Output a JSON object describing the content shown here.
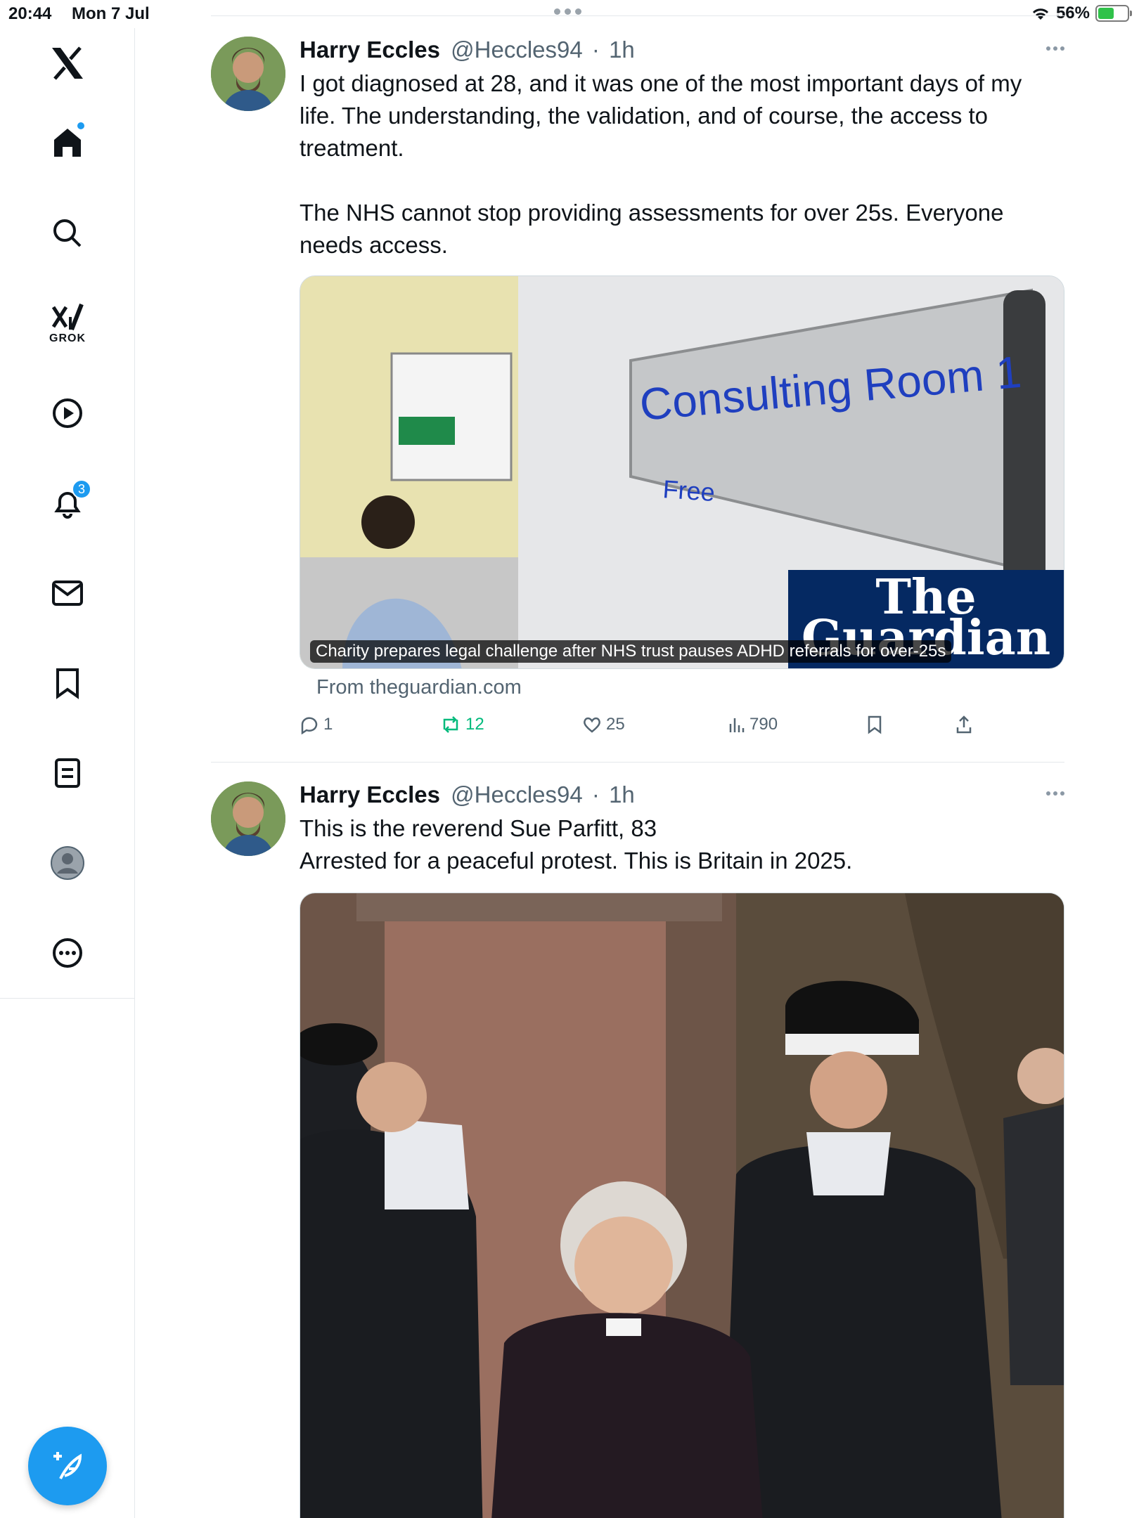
{
  "status_bar": {
    "time": "20:44",
    "date": "Mon 7 Jul",
    "battery": "56%",
    "battery_level": 0.56
  },
  "sidebar": {
    "items": [
      {
        "name": "x-logo-icon"
      },
      {
        "name": "home-icon",
        "has_dot": true
      },
      {
        "name": "search-icon"
      },
      {
        "name": "grok-icon",
        "label": "GROK"
      },
      {
        "name": "video-icon"
      },
      {
        "name": "notifications-icon",
        "badge": "3"
      },
      {
        "name": "messages-icon"
      },
      {
        "name": "bookmarks-icon"
      },
      {
        "name": "lists-icon"
      },
      {
        "name": "profile-icon"
      },
      {
        "name": "more-icon"
      }
    ],
    "compose_icon": "compose-feather-icon",
    "accent_color": "#1d9bf0"
  },
  "feed": {
    "tweets": [
      {
        "name": "Harry Eccles",
        "handle": "@Heccles94",
        "separator": "·",
        "time": "1h",
        "text_lines": [
          "I got diagnosed at 28, and it was one of the most important days of my",
          "life. The understanding, the validation, and of course, the access to",
          "treatment.",
          "The NHS cannot stop providing assessments for over 25s. Everyone",
          "needs access."
        ],
        "card": {
          "sign_text": "Consulting Room 1",
          "sign_sub": "Free",
          "caption": "Charity prepares legal challenge after NHS trust pauses ADHD referrals for over-25s",
          "logo_line1": "The",
          "logo_line2": "Guardian",
          "source": "From theguardian.com"
        },
        "stats": {
          "replies": "1",
          "reposts": "12",
          "likes": "25",
          "views": "790"
        }
      },
      {
        "name": "Harry Eccles",
        "handle": "@Heccles94",
        "separator": "·",
        "time": "1h",
        "text_lines": [
          "This is the reverend Sue Parfitt, 83",
          "Arrested for a peaceful protest. This is Britain in 2025."
        ]
      }
    ]
  }
}
